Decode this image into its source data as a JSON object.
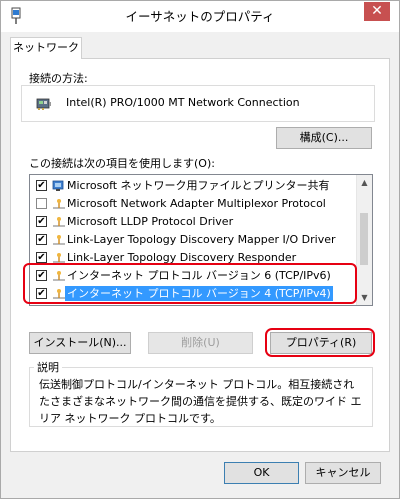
{
  "window": {
    "title": "イーサネットのプロパティ",
    "close_glyph": "✕",
    "close_color": "#c75050"
  },
  "tabs": [
    {
      "label": "ネットワーク",
      "active": true
    }
  ],
  "connect_using": {
    "label": "接続の方法:",
    "adapter_name": "Intel(R) PRO/1000 MT Network Connection",
    "adapter_icon": "network-adapter-icon",
    "configure_label": "構成(C)..."
  },
  "items_section": {
    "label": "この接続は次の項目を使用します(O):",
    "items": [
      {
        "label": "Microsoft ネットワーク用ファイルとプリンター共有",
        "checked": true,
        "icon": "service-icon",
        "selected": false
      },
      {
        "label": "Microsoft Network Adapter Multiplexor Protocol",
        "checked": false,
        "icon": "protocol-icon",
        "selected": false
      },
      {
        "label": "Microsoft LLDP Protocol Driver",
        "checked": true,
        "icon": "protocol-icon",
        "selected": false
      },
      {
        "label": "Link-Layer Topology Discovery Mapper I/O Driver",
        "checked": true,
        "icon": "protocol-icon",
        "selected": false
      },
      {
        "label": "Link-Layer Topology Discovery Responder",
        "checked": true,
        "icon": "protocol-icon",
        "selected": false
      },
      {
        "label": "インターネット プロトコル バージョン 6 (TCP/IPv6)",
        "checked": true,
        "icon": "protocol-icon",
        "selected": false
      },
      {
        "label": "インターネット プロトコル バージョン 4 (TCP/IPv4)",
        "checked": true,
        "icon": "protocol-icon",
        "selected": true
      }
    ]
  },
  "buttons": {
    "install": "インストール(N)...",
    "uninstall": "削除(U)",
    "properties": "プロパティ(R)",
    "ok": "OK",
    "cancel": "キャンセル"
  },
  "description": {
    "title": "説明",
    "text": "伝送制御プロトコル/インターネット プロトコル。相互接続されたさまざまなネットワーク間の通信を提供する、既定のワイド エリア ネットワーク プロトコルです。"
  },
  "colors": {
    "highlight": "#e60012",
    "selection": "#3399ff"
  }
}
